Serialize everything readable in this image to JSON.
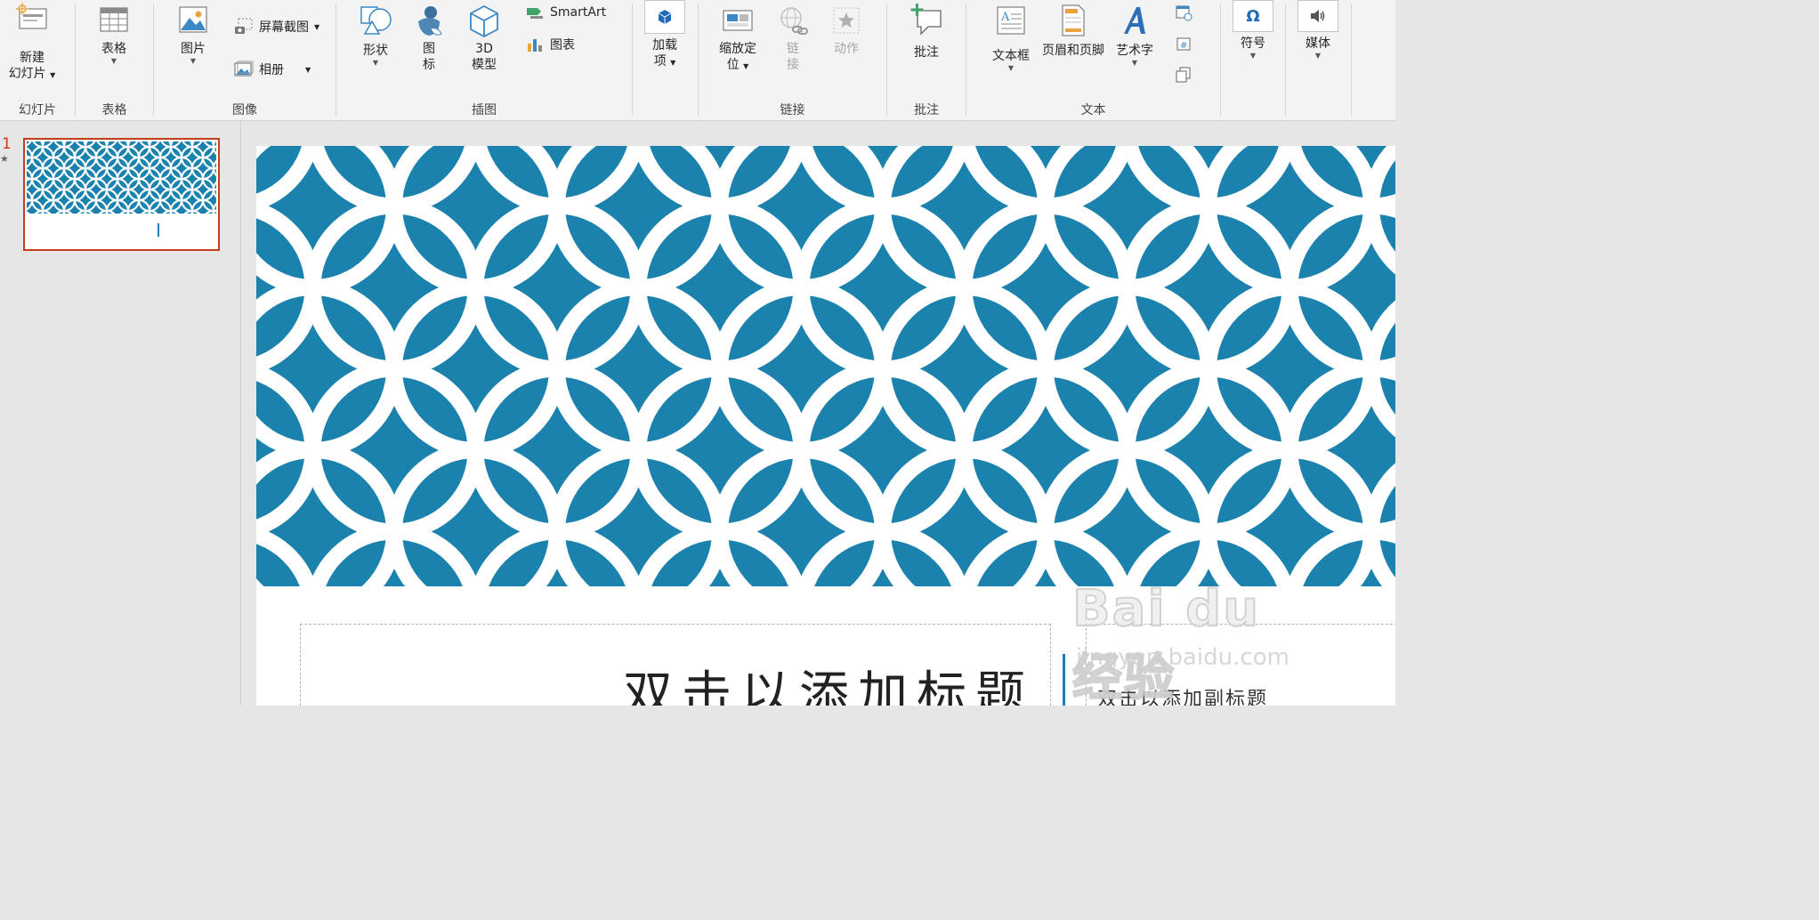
{
  "ribbon": {
    "groups": {
      "slides": "幻灯片",
      "tables": "表格",
      "images": "图像",
      "illustrations": "插图",
      "links": "链接",
      "comments": "批注",
      "text": "文本"
    },
    "new_slide": {
      "line1": "新建",
      "line2": "幻灯片"
    },
    "table": "表格",
    "pictures": "图片",
    "screenshot": "屏幕截图",
    "album": "相册",
    "shapes": "形状",
    "icons": {
      "line1": "图",
      "line2": "标"
    },
    "model3d": {
      "line1": "3D",
      "line2": "模型"
    },
    "smartart": "SmartArt",
    "chart": "图表",
    "addins": {
      "line1": "加载",
      "line2": "项"
    },
    "zoom": {
      "line1": "缩放定",
      "line2": "位"
    },
    "link": {
      "line1": "链",
      "line2": "接"
    },
    "action": "动作",
    "comment": "批注",
    "textbox": "文本框",
    "header_footer": "页眉和页脚",
    "wordart": "艺术字",
    "symbols": "符号",
    "media": "媒体"
  },
  "thumbnails": {
    "slide_number": "1",
    "star": "★"
  },
  "slide": {
    "title_placeholder": "双击以添加标题",
    "subtitle_placeholder": "双击以添加副标题"
  },
  "watermark": {
    "main": "Bai du 经验",
    "sub": "jingyan.baidu.com"
  },
  "colors": {
    "accent": "#1a82ad",
    "selection": "#c43e1c"
  }
}
